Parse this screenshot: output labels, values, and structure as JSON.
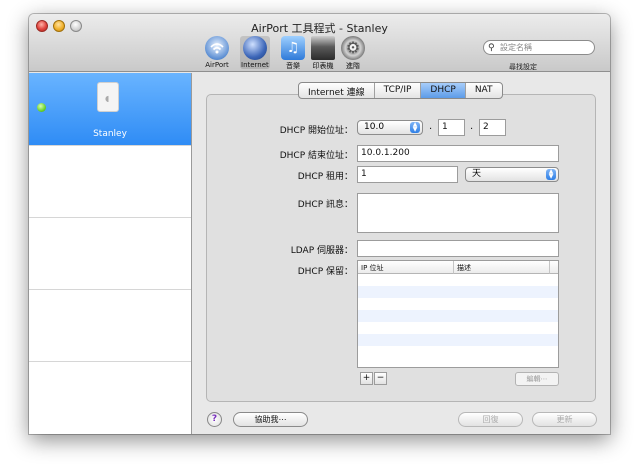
{
  "window": {
    "title": "AirPort 工具程式 - Stanley"
  },
  "toolbar": {
    "items": [
      {
        "label": "AirPort",
        "icon": "airport-icon"
      },
      {
        "label": "Internet",
        "icon": "internet-icon"
      },
      {
        "label": "音樂",
        "icon": "music-icon"
      },
      {
        "label": "印表機",
        "icon": "printer-icon"
      },
      {
        "label": "進階",
        "icon": "advanced-gear-icon"
      }
    ],
    "search_placeholder": "設定名稱",
    "search_caption": "尋找設定"
  },
  "sidebar": {
    "devices": [
      {
        "name": "Stanley",
        "status_color": "#5cc52a"
      }
    ]
  },
  "tabs": [
    {
      "label": "Internet 連線",
      "active": false
    },
    {
      "label": "TCP/IP",
      "active": false
    },
    {
      "label": "DHCP",
      "active": true
    },
    {
      "label": "NAT",
      "active": false
    }
  ],
  "dhcp": {
    "start_label": "DHCP 開始位址：",
    "start_prefix": "10.0",
    "start_octet3": "1",
    "start_octet4": "2",
    "end_label": "DHCP 結束位址：",
    "end_value": "10.0.1.200",
    "lease_label": "DHCP 租用：",
    "lease_value": "1",
    "lease_unit": "天",
    "message_label": "DHCP 訊息：",
    "message_value": "",
    "ldap_label": "LDAP 伺服器：",
    "ldap_value": "",
    "reservations_label": "DHCP 保留：",
    "table_headers": [
      "IP 位址",
      "描述"
    ],
    "add_label": "+",
    "remove_label": "−",
    "edit_label": "編輯⋯"
  },
  "footer": {
    "help_label": "?",
    "assist_label": "協助我⋯",
    "revert_label": "回復",
    "update_label": "更新"
  },
  "colors": {
    "selection": "#3b8ff5",
    "active_tab": "#6aa6ee"
  }
}
